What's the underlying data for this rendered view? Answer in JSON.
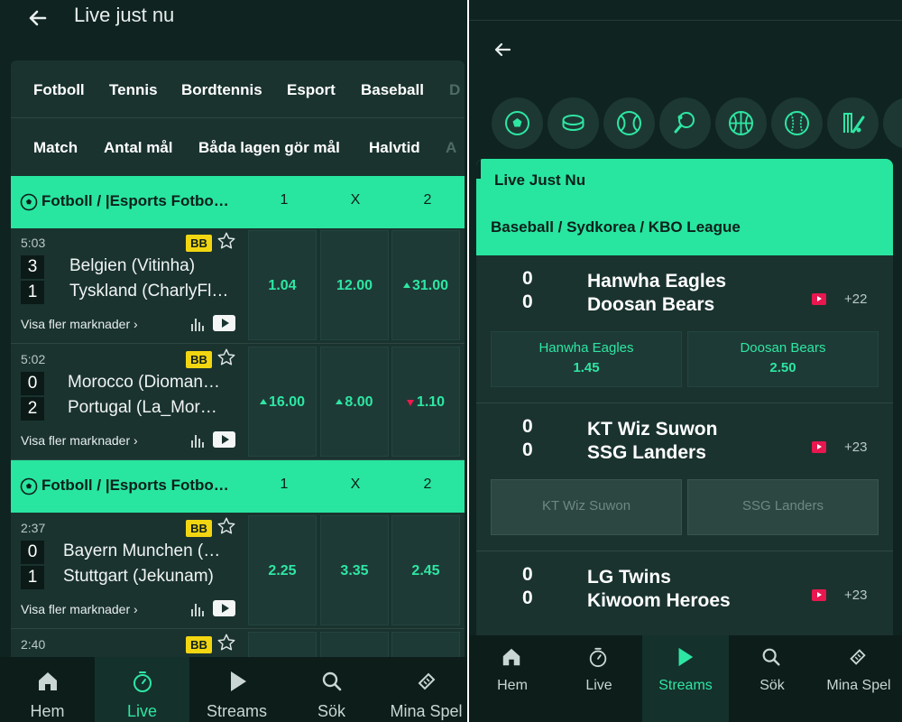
{
  "left": {
    "header": {
      "title": "Live just nu"
    },
    "sport_tabs": [
      "Fotboll",
      "Tennis",
      "Bordtennis",
      "Esport",
      "Baseball",
      "D"
    ],
    "market_tabs": [
      "Match",
      "Antal mål",
      "Båda lagen gör mål",
      "Halvtid",
      "A"
    ],
    "section_header": {
      "name": "Fotboll / |Esports Fotbo…",
      "col1": "1",
      "colx": "X",
      "col2": "2"
    },
    "events": [
      {
        "time": "5:03",
        "badge": "BB",
        "home": "Belgien (Vitinha)",
        "away": "Tyskland (CharlyFl…",
        "home_score": "3",
        "away_score": "1",
        "more": "Visa fler marknader ›",
        "odds": [
          "1.04",
          "12.00",
          "31.00"
        ],
        "trend": [
          "",
          "",
          "up"
        ]
      },
      {
        "time": "5:02",
        "badge": "BB",
        "home": "Morocco (Dioman…",
        "away": "Portugal (La_Mor…",
        "home_score": "0",
        "away_score": "2",
        "more": "Visa fler marknader ›",
        "odds": [
          "16.00",
          "8.00",
          "1.10"
        ],
        "trend": [
          "up",
          "up",
          "down"
        ]
      },
      {
        "time": "2:37",
        "badge": "BB",
        "home": "Bayern Munchen (…",
        "away": "Stuttgart (Jekunam)",
        "home_score": "0",
        "away_score": "1",
        "more": "Visa fler marknader ›",
        "odds": [
          "2.25",
          "3.35",
          "2.45"
        ],
        "trend": [
          "",
          "",
          ""
        ]
      },
      {
        "time": "2:40",
        "badge": "BB"
      }
    ],
    "nav": [
      {
        "label": "Hem",
        "icon": "home-icon"
      },
      {
        "label": "Live",
        "icon": "stopwatch-icon",
        "active": true
      },
      {
        "label": "Streams",
        "icon": "play-icon"
      },
      {
        "label": "Sök",
        "icon": "search-icon"
      },
      {
        "label": "Mina Spel",
        "icon": "ticket-icon"
      }
    ]
  },
  "right": {
    "sport_icons": [
      "soccer-ball-icon",
      "hockey-puck-icon",
      "tennis-ball-icon",
      "table-tennis-icon",
      "basketball-icon",
      "baseball-icon",
      "cricket-icon"
    ],
    "section_title": "Live Just Nu",
    "league": "Baseball / Sydkorea / KBO League",
    "matches": [
      {
        "home": "Hanwha Eagles",
        "away": "Doosan Bears",
        "home_score": "0",
        "away_score": "0",
        "more": "+22",
        "bets": [
          {
            "name": "Hanwha Eagles",
            "odds": "1.45"
          },
          {
            "name": "Doosan Bears",
            "odds": "2.50"
          }
        ],
        "disabled": false
      },
      {
        "home": "KT Wiz Suwon",
        "away": "SSG Landers",
        "home_score": "0",
        "away_score": "0",
        "more": "+23",
        "bets": [
          {
            "name": "KT Wiz Suwon",
            "odds": ""
          },
          {
            "name": "SSG Landers",
            "odds": ""
          }
        ],
        "disabled": true
      },
      {
        "home": "LG Twins",
        "away": "Kiwoom Heroes",
        "home_score": "0",
        "away_score": "0",
        "more": "+23"
      }
    ],
    "nav": [
      {
        "label": "Hem",
        "icon": "home-icon"
      },
      {
        "label": "Live",
        "icon": "stopwatch-icon"
      },
      {
        "label": "Streams",
        "icon": "play-icon",
        "active": true
      },
      {
        "label": "Sök",
        "icon": "search-icon"
      },
      {
        "label": "Mina Spel",
        "icon": "ticket-icon"
      }
    ]
  },
  "colors": {
    "accent": "#28e6a0",
    "odds_text": "#2ee6a3",
    "background": "#0f2320",
    "panel": "#1a332f",
    "badge": "#f2d611",
    "down": "#f0174c",
    "stream": "#e8174f"
  }
}
